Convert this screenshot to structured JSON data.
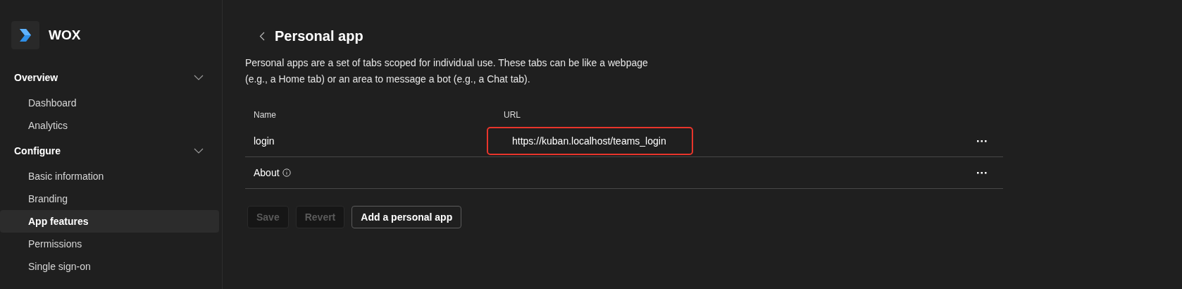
{
  "app": {
    "name": "WOX"
  },
  "sidebar": {
    "sections": [
      {
        "label": "Overview",
        "expanded": true,
        "items": [
          {
            "label": "Dashboard",
            "selected": false
          },
          {
            "label": "Analytics",
            "selected": false
          }
        ]
      },
      {
        "label": "Configure",
        "expanded": true,
        "items": [
          {
            "label": "Basic information",
            "selected": false
          },
          {
            "label": "Branding",
            "selected": false
          },
          {
            "label": "App features",
            "selected": true
          },
          {
            "label": "Permissions",
            "selected": false
          },
          {
            "label": "Single sign-on",
            "selected": false
          }
        ]
      }
    ]
  },
  "page": {
    "title": "Personal app",
    "description": "Personal apps are a set of tabs scoped for individual use. These tabs can be like a webpage (e.g., a Home tab) or an area to message a bot (e.g., a Chat tab)."
  },
  "table": {
    "columns": [
      "Name",
      "URL"
    ],
    "rows": [
      {
        "name": "login",
        "url": "https://kuban.localhost/teams_login",
        "info": false,
        "highlighted": true
      },
      {
        "name": "About",
        "url": "",
        "info": true,
        "highlighted": false
      }
    ]
  },
  "buttons": [
    {
      "label": "Save",
      "disabled": true
    },
    {
      "label": "Revert",
      "disabled": true
    },
    {
      "label": "Add a personal app",
      "disabled": false
    }
  ]
}
